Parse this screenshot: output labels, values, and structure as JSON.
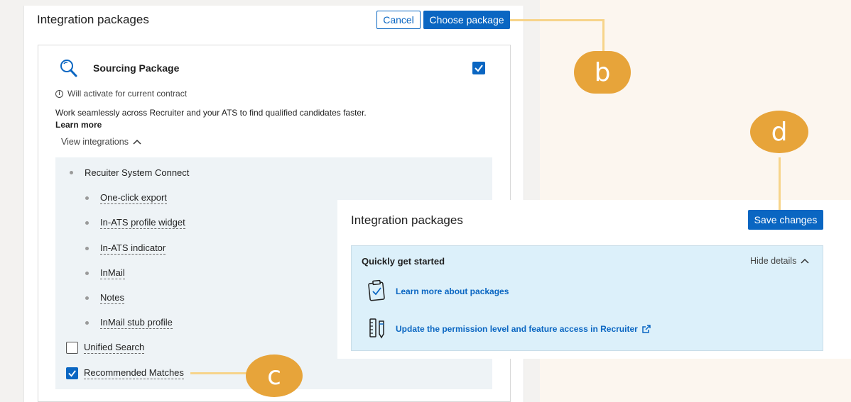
{
  "back_panel": {
    "title": "Integration packages",
    "cancel_label": "Cancel",
    "choose_label": "Choose package",
    "package": {
      "title": "Sourcing Package",
      "selected": true,
      "info": "Will activate for current contract",
      "description": "Work seamlessly across Recruiter and your ATS to find qualified candidates faster.",
      "learn_more": "Learn more",
      "view_integrations": "View integrations",
      "system_connect": "Recuiter System Connect",
      "sub_items": [
        "One-click export",
        "In-ATS profile widget",
        "In-ATS indicator",
        "InMail",
        "Notes",
        "InMail stub profile"
      ],
      "unified_search": "Unified Search",
      "recommended_matches": "Recommended Matches"
    }
  },
  "front_panel": {
    "title": "Integration packages",
    "save_label": "Save changes",
    "quick_start": {
      "title": "Quickly get started",
      "hide_details": "Hide details",
      "link1": "Learn more about packages",
      "link2": "Update the permission level and feature access in Recruiter"
    }
  },
  "callouts": {
    "b": "b",
    "c": "c",
    "d": "d"
  },
  "colors": {
    "primary": "#0a66c2",
    "callout": "#e7a43a",
    "callout_line": "#f7d48a",
    "quick_start_bg": "#dcf0fa"
  }
}
